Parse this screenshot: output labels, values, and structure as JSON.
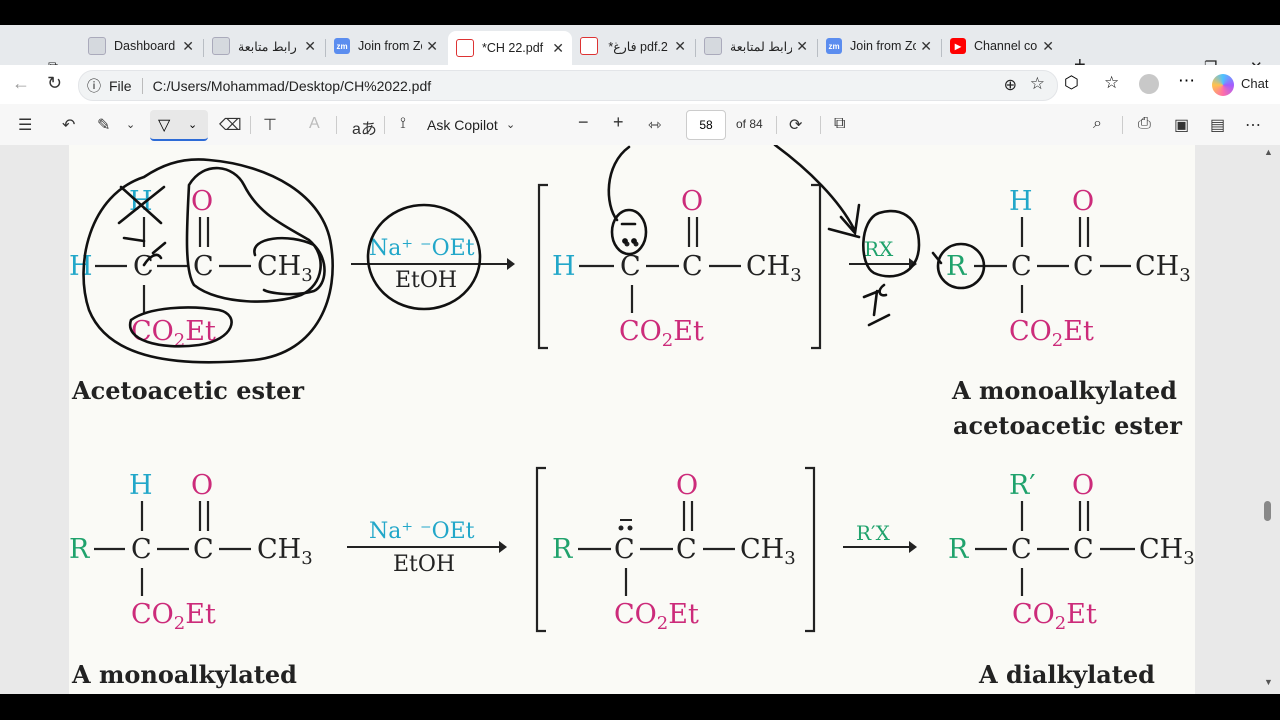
{
  "tabs": [
    {
      "label": "Dashboard |",
      "icon": "page-icon"
    },
    {
      "label": "رابط متابعة JI",
      "icon": "page-icon"
    },
    {
      "label": "Join from Zo",
      "icon": "zoom-icon"
    },
    {
      "label": "*CH 22.pdf",
      "icon": "pdf-icon"
    },
    {
      "label": "*فارغ pdf.2",
      "icon": "pdf-icon"
    },
    {
      "label": "رابط لمتابعة",
      "icon": "page-icon"
    },
    {
      "label": "Join from Zo",
      "icon": "zoom-icon"
    },
    {
      "label": "Channel con",
      "icon": "youtube-icon"
    }
  ],
  "address": {
    "scheme_label": "File",
    "url": "C:/Users/Mohammad/Desktop/CH%2022.pdf"
  },
  "chat_label": "Chat",
  "pdf_toolbar": {
    "copilot_label": "Ask Copilot",
    "page_number": "58",
    "page_total": "of 84"
  },
  "chem": {
    "H": "H",
    "O": "O",
    "C": "C",
    "CH3": "CH",
    "sub3": "3",
    "CO2Et_a": "CO",
    "sub2": "2",
    "CO2Et_b": "Et",
    "R": "R",
    "Rp": "R′",
    "RX": "RX",
    "RpX": "R′X",
    "reagent_top": "Na⁺ ⁻OEt",
    "solvent": "EtOH",
    "label_acetoacetic": "Acetoacetic ester",
    "label_mono1": "A monoalkylated",
    "label_mono2": "acetoacetic ester",
    "label_mono_bottom": "A monoalkylated",
    "label_di": "A dialkylated",
    "anion_mark": "−",
    "x_mark": "X"
  },
  "colors": {
    "cyan": "#22a7c9",
    "magenta": "#cc2b7a",
    "green": "#1fa26c",
    "ink": "#222"
  }
}
